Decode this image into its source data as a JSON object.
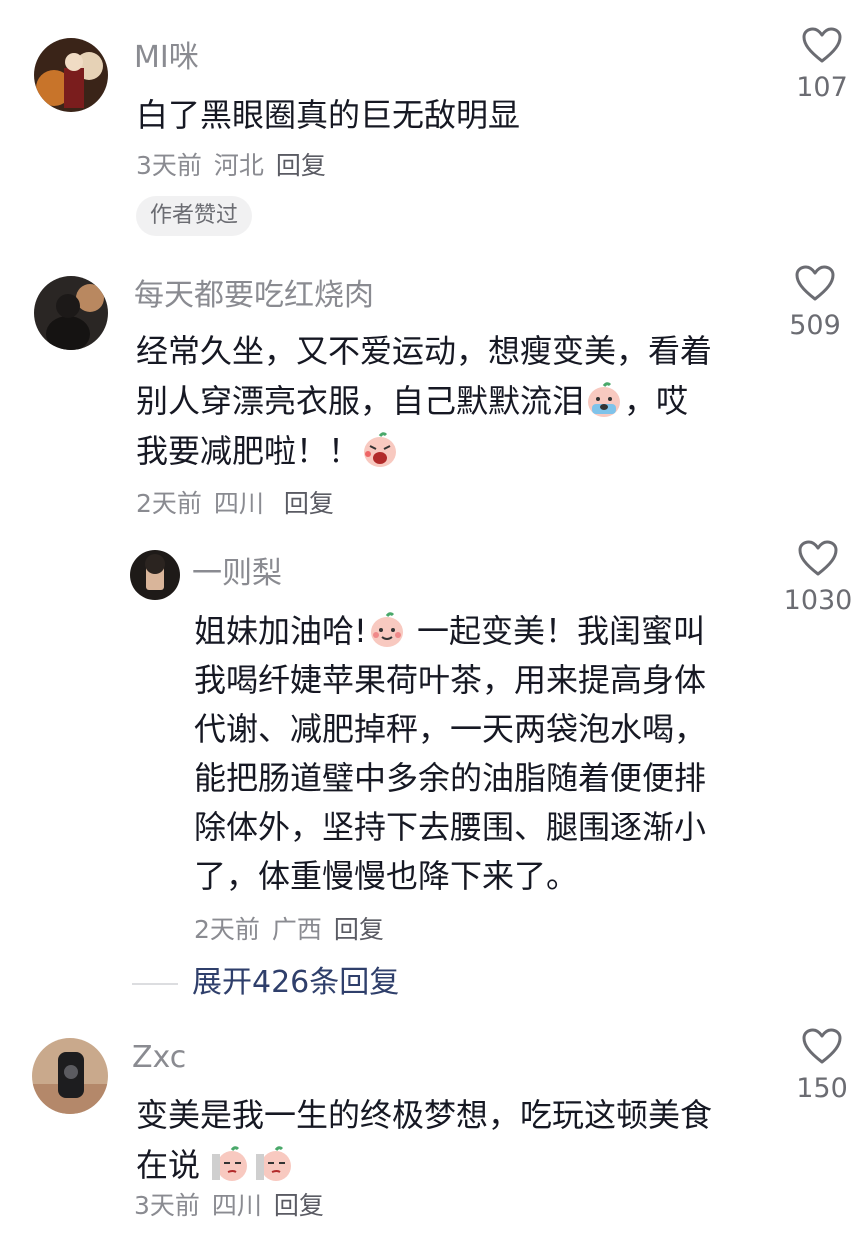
{
  "comments": [
    {
      "name": "MI咪",
      "text": "白了黑眼圈真的巨无敌明显",
      "time": "3天前",
      "location": "河北",
      "reply": "回复",
      "badge": "作者赞过",
      "likes": "107"
    },
    {
      "name": "每天都要吃红烧肉",
      "text_line1": "经常久坐，又不爱运动，想瘦变美，看着",
      "text_line2a": "别人穿漂亮衣服，自己默默流泪",
      "text_line2b": "，哎",
      "text_line3": "我要减肥啦！！",
      "time": "2天前",
      "location": "四川",
      "reply": "回复",
      "likes": "509"
    },
    {
      "name": "Zxc",
      "text_line1": "变美是我一生的终极梦想，吃玩这顿美食",
      "text_line2": "在说",
      "time": "3天前",
      "location": "四川",
      "reply": "回复",
      "likes": "150"
    }
  ],
  "sub_reply": {
    "name": "一则梨",
    "text_line1a": "姐妹加油哈!",
    "text_line1b": " 一起变美！我闺蜜叫",
    "text_line2": "我喝纤婕苹果荷叶茶，用来提高身体",
    "text_line3": "代谢、减肥掉秤，一天两袋泡水喝，",
    "text_line4": "能把肠道璧中多余的油脂随着便便排",
    "text_line5": "除体外，坚持下去腰围、腿围逐渐小",
    "text_line6": "了，体重慢慢也降下来了。",
    "time": "2天前",
    "location": "广西",
    "reply": "回复",
    "likes": "1030"
  },
  "expand_label": "展开426条回复",
  "icons": {
    "like": "heart-outline-icon",
    "emoji_cry": "crying-face-emoji",
    "emoji_angry": "shouting-face-emoji",
    "emoji_smile": "smiling-face-emoji",
    "emoji_sly": "sly-face-emoji"
  },
  "colors": {
    "text": "#161823",
    "secondary": "#8a8b91",
    "link": "#2f3f6b"
  }
}
